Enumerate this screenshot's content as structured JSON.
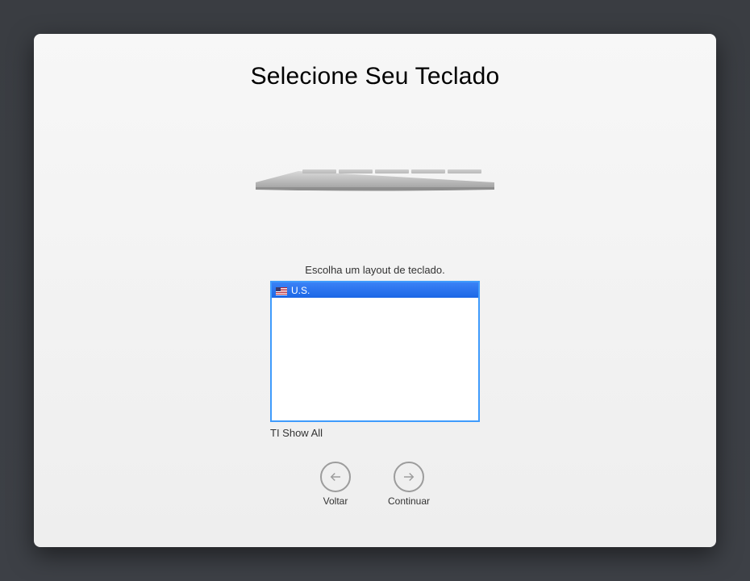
{
  "title": "Selecione Seu Teclado",
  "subtitle": "Escolha um layout de teclado.",
  "listbox": {
    "selected": {
      "label": "U.S.",
      "flag": "us"
    }
  },
  "show_all_label": "TI Show All",
  "nav": {
    "back": "Voltar",
    "continue": "Continuar"
  }
}
